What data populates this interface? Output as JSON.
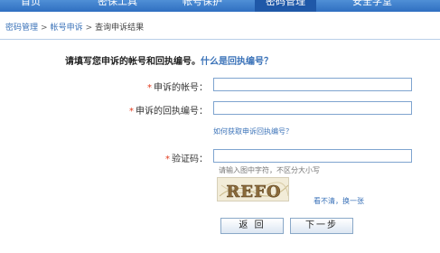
{
  "nav": {
    "items": [
      {
        "label": "首页"
      },
      {
        "label": "密保工具"
      },
      {
        "label": "帐号保护"
      },
      {
        "label": "密码管理"
      },
      {
        "label": "安全学堂"
      }
    ]
  },
  "breadcrumb": {
    "items": [
      "密码管理",
      "帐号申诉",
      "查询申诉结果"
    ],
    "separator": ">"
  },
  "form": {
    "title": "请填写您申诉的帐号和回执编号",
    "title_sep": "。",
    "help_title_link": "什么是回执编号？",
    "required_mark": "*",
    "account_label": "申诉的帐号：",
    "account_value": "",
    "receipt_label": "申诉的回执编号：",
    "receipt_value": "",
    "receipt_help_link": "如何获取申诉回执编号？",
    "captcha_label": "验证码：",
    "captcha_value": "",
    "captcha_hint": "请输入图中字符，不区分大小写",
    "captcha_text": "REFO",
    "refresh_link": "看不清，换一张",
    "back_button": "返 回",
    "next_button": "下一步"
  },
  "colors": {
    "nav_bg": "#3a7bd0",
    "link": "#3a72b8",
    "required": "#e23a1c",
    "input_border": "#7fa4cf"
  }
}
